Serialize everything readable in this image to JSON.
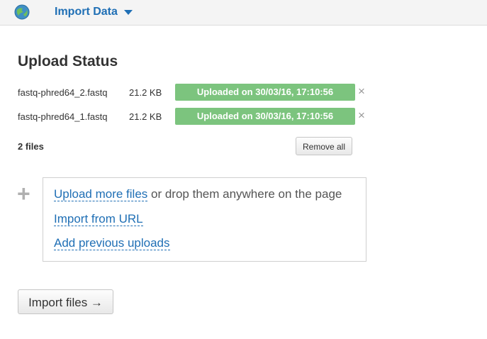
{
  "header": {
    "menu_label": "Import Data",
    "logo_icon": "galaxy-logo-icon",
    "caret_icon": "caret-down-icon"
  },
  "upload": {
    "title": "Upload Status",
    "files": [
      {
        "name": "fastq-phred64_2.fastq",
        "size": "21.2 KB",
        "status": "Uploaded on 30/03/16, 17:10:56",
        "remove_icon": "×"
      },
      {
        "name": "fastq-phred64_1.fastq",
        "size": "21.2 KB",
        "status": "Uploaded on 30/03/16, 17:10:56",
        "remove_icon": "×"
      }
    ],
    "count_label": "2 files",
    "remove_all_label": "Remove all"
  },
  "dropzone": {
    "plus_icon": "+",
    "upload_more_link": "Upload more files",
    "upload_more_text": " or drop them anywhere on the page",
    "import_url_link": "Import from URL",
    "previous_uploads_link": "Add previous uploads"
  },
  "actions": {
    "import_files_label": "Import files →"
  },
  "colors": {
    "accent": "#1f6fb5",
    "success": "#7cc47e"
  }
}
